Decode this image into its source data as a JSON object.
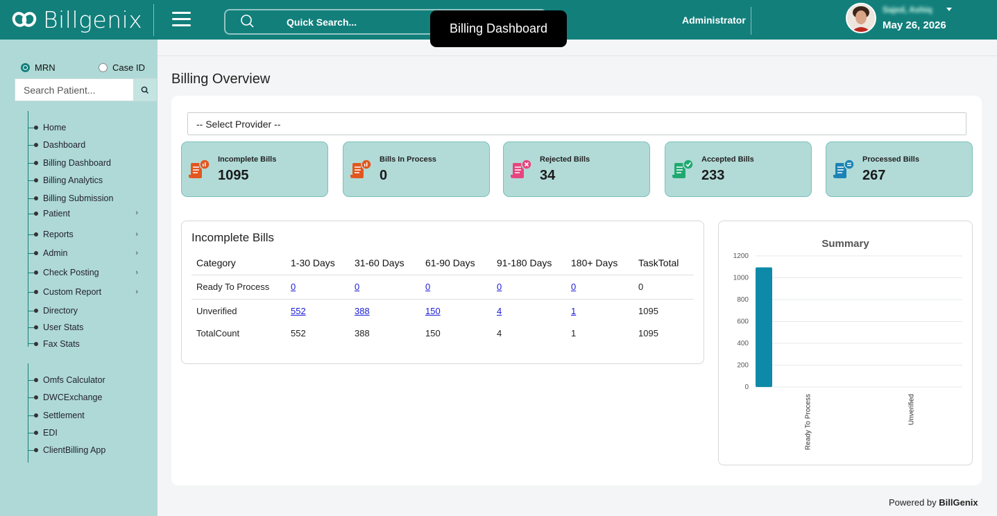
{
  "header": {
    "logo_text": "Billgenix",
    "search_placeholder": "Quick Search...",
    "page_badge": "Billing Dashboard",
    "role": "Administrator",
    "user_name": "Sajed, Ashiq",
    "date": "May 26, 2026"
  },
  "sidebar": {
    "radio_mrn": "MRN",
    "radio_caseid": "Case ID",
    "patient_search_placeholder": "Search Patient...",
    "nav_items": [
      {
        "label": "Home"
      },
      {
        "label": "Dashboard"
      },
      {
        "label": "Billing Dashboard"
      },
      {
        "label": "Billing Analytics"
      },
      {
        "label": "Billing Submission"
      },
      {
        "label": "Patient"
      },
      {
        "label": "Reports"
      },
      {
        "label": "Admin"
      },
      {
        "label": "Check Posting"
      },
      {
        "label": "Custom Report"
      },
      {
        "label": "Directory"
      },
      {
        "label": "User Stats"
      },
      {
        "label": "Fax Stats"
      }
    ],
    "tools": [
      {
        "label": "Omfs Calculator"
      },
      {
        "label": "DWCExchange"
      },
      {
        "label": "Settlement"
      },
      {
        "label": "EDI"
      },
      {
        "label": "ClientBilling App"
      }
    ]
  },
  "main": {
    "title": "Billing Overview",
    "provider_select": "-- Select Provider --",
    "stats": [
      {
        "label": "Incomplete Bills",
        "value": "1095",
        "icon": "bill-chart-icon",
        "color": "#e2571f"
      },
      {
        "label": "Bills In Process",
        "value": "0",
        "icon": "bill-chart-icon",
        "color": "#e2571f"
      },
      {
        "label": "Rejected Bills",
        "value": "34",
        "icon": "bill-rejected-icon",
        "color": "#e8457e"
      },
      {
        "label": "Accepted Bills",
        "value": "233",
        "icon": "bill-accepted-icon",
        "color": "#1fa971"
      },
      {
        "label": "Processed Bills",
        "value": "267",
        "icon": "bill-processed-icon",
        "color": "#1b83b5"
      }
    ],
    "incomplete_table": {
      "title": "Incomplete Bills",
      "headers": [
        "Category",
        "1-30 Days",
        "31-60 Days",
        "61-90 Days",
        "91-180 Days",
        "180+ Days",
        "TaskTotal"
      ],
      "rows": [
        {
          "category": "Ready To Process",
          "d1": "0",
          "d2": "0",
          "d3": "0",
          "d4": "0",
          "d5": "0",
          "total": "0"
        },
        {
          "category": "Unverified",
          "d1": "552",
          "d2": "388",
          "d3": "150",
          "d4": "4",
          "d5": "1",
          "total": "1095"
        },
        {
          "category": "TotalCount",
          "d1": "552",
          "d2": "388",
          "d3": "150",
          "d4": "4",
          "d5": "1",
          "total": "1095"
        }
      ]
    },
    "footer_prefix": "Powered by",
    "footer_brand": "BillGenix"
  },
  "chart_data": {
    "type": "bar",
    "title": "Summary",
    "categories": [
      "Ready To Process",
      "Unverified"
    ],
    "values": [
      1095,
      0
    ],
    "yticks": [
      0,
      200,
      400,
      600,
      800,
      1000,
      1200
    ],
    "ylim": [
      0,
      1200
    ],
    "color": "#0e8aa8",
    "grid": true
  }
}
